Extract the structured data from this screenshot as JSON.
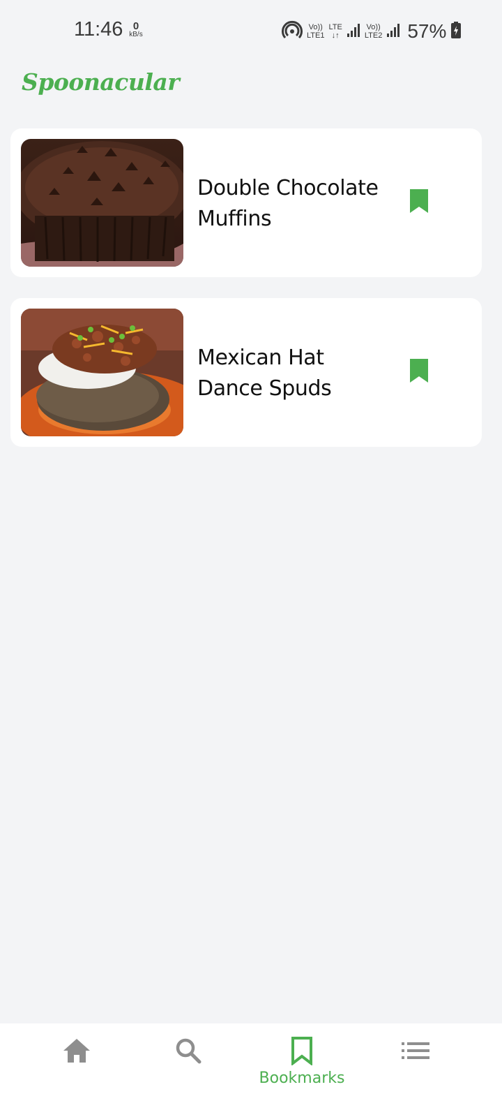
{
  "status_bar": {
    "time": "11:46",
    "speed_value": "0",
    "speed_unit": "kB/s",
    "sim1_tag_top": "Vo))",
    "sim1_tag_bottom": "LTE1",
    "data_tag_top": "LTE",
    "data_tag_bottom": "↓↑",
    "sim2_tag_top": "Vo))",
    "sim2_tag_bottom": "LTE2",
    "battery_percent": "57%",
    "icons": [
      "hotspot-icon",
      "signal-icon",
      "battery-charging-icon"
    ]
  },
  "app": {
    "title": "Spoonacular",
    "accent_color": "#4caf50"
  },
  "bookmarks": [
    {
      "title_line1": "Double Chocolate",
      "title_line2": "Muffins",
      "image": "chocolate-muffin-photo",
      "bookmarked": true
    },
    {
      "title_line1": "Mexican Hat",
      "title_line2": "Dance Spuds",
      "image": "baked-potato-chili-photo",
      "bookmarked": true
    }
  ],
  "bottom_nav": {
    "items": [
      {
        "icon": "home-icon",
        "label": "",
        "active": false
      },
      {
        "icon": "search-icon",
        "label": "",
        "active": false
      },
      {
        "icon": "bookmark-icon",
        "label": "Bookmarks",
        "active": true
      },
      {
        "icon": "list-icon",
        "label": "",
        "active": false
      }
    ]
  }
}
